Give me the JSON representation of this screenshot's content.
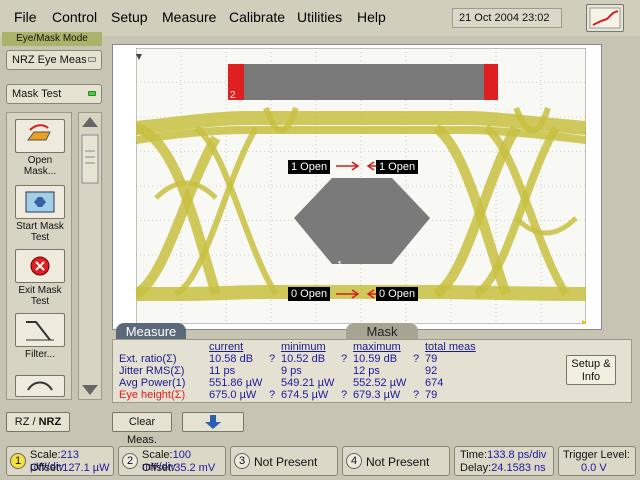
{
  "menu": {
    "items": [
      {
        "label": "File",
        "key": "F"
      },
      {
        "label": "Control",
        "key": "C"
      },
      {
        "label": "Setup",
        "key": "S"
      },
      {
        "label": "Measure",
        "key": "M"
      },
      {
        "label": "Calibrate",
        "key": "C"
      },
      {
        "label": "Utilities",
        "key": "U"
      },
      {
        "label": "Help",
        "key": "H"
      }
    ],
    "datetime": "21 Oct 2004   23:02"
  },
  "left_panel": {
    "mode_label": "Eye/Mask Mode",
    "measure_select": "NRZ Eye Meas",
    "mask_test": "Mask Test",
    "tools": [
      {
        "label": "Open Mask...",
        "icon": "open-mask-icon"
      },
      {
        "label": "Start Mask Test",
        "icon": "start-mask-icon"
      },
      {
        "label": "Exit Mask Test",
        "icon": "exit-mask-icon"
      },
      {
        "label": "Filter...",
        "icon": "filter-icon"
      }
    ],
    "rz_nrz": {
      "rz": "RZ",
      "sep": " / ",
      "nrz": "NRZ"
    }
  },
  "screen": {
    "open_labels": {
      "tl": "1 Open",
      "tr": "1 Open",
      "bl": "0 Open",
      "br": "0 Open"
    },
    "mask_region_labels": {
      "top": "2",
      "center": "1"
    },
    "colors": {
      "trace": "#c8c040",
      "mask": "#7a7a7a",
      "violation": "#e02020",
      "grid": "#a8a890"
    }
  },
  "measure": {
    "tab_active": "Measure",
    "tab_inactive": "Mask",
    "headers": {
      "current": "current",
      "minimum": "minimum",
      "maximum": "maximum",
      "total": "total meas"
    },
    "rows": [
      {
        "name": "Ext. ratio(Σ)",
        "current": "10.58 dB",
        "q1": "?",
        "minimum": "10.52 dB",
        "q2": "?",
        "maximum": "10.59 dB",
        "q3": "?",
        "total": "79",
        "highlight": false
      },
      {
        "name": "Jitter RMS(Σ)",
        "current": "11 ps",
        "q1": "",
        "minimum": "9 ps",
        "q2": "",
        "maximum": "12 ps",
        "q3": "",
        "total": "92",
        "highlight": false
      },
      {
        "name": "Avg Power(1)",
        "current": "551.86 µW",
        "q1": "",
        "minimum": "549.21 µW",
        "q2": "",
        "maximum": "552.52 µW",
        "q3": "",
        "total": "674",
        "highlight": false
      },
      {
        "name": "Eye height(Σ)",
        "current": "675.0 µW",
        "q1": "?",
        "minimum": "674.5 µW",
        "q2": "?",
        "maximum": "679.3 µW",
        "q3": "?",
        "total": "79",
        "highlight": true
      }
    ],
    "setup_info": "Setup & Info"
  },
  "bottom": {
    "clear_meas": "Clear Meas.",
    "channels": [
      {
        "num": "1",
        "line1": "Scale:",
        "val1": "213 µW/div",
        "line2": "Offset:",
        "val2": "127.1 µW"
      },
      {
        "num": "2",
        "line1": "Scale:",
        "val1": "100 mV/div",
        "line2": "Offset:",
        "val2": "35.2 mV"
      },
      {
        "num": "3",
        "status": "Not Present"
      },
      {
        "num": "4",
        "status": "Not Present"
      }
    ],
    "time": {
      "label1": "Time:",
      "val1": "133.8 ps/div",
      "label2": "Delay:",
      "val2": "24.1583 ns"
    },
    "trigger": {
      "label": "Trigger Level:",
      "value": "0.0 V"
    }
  }
}
